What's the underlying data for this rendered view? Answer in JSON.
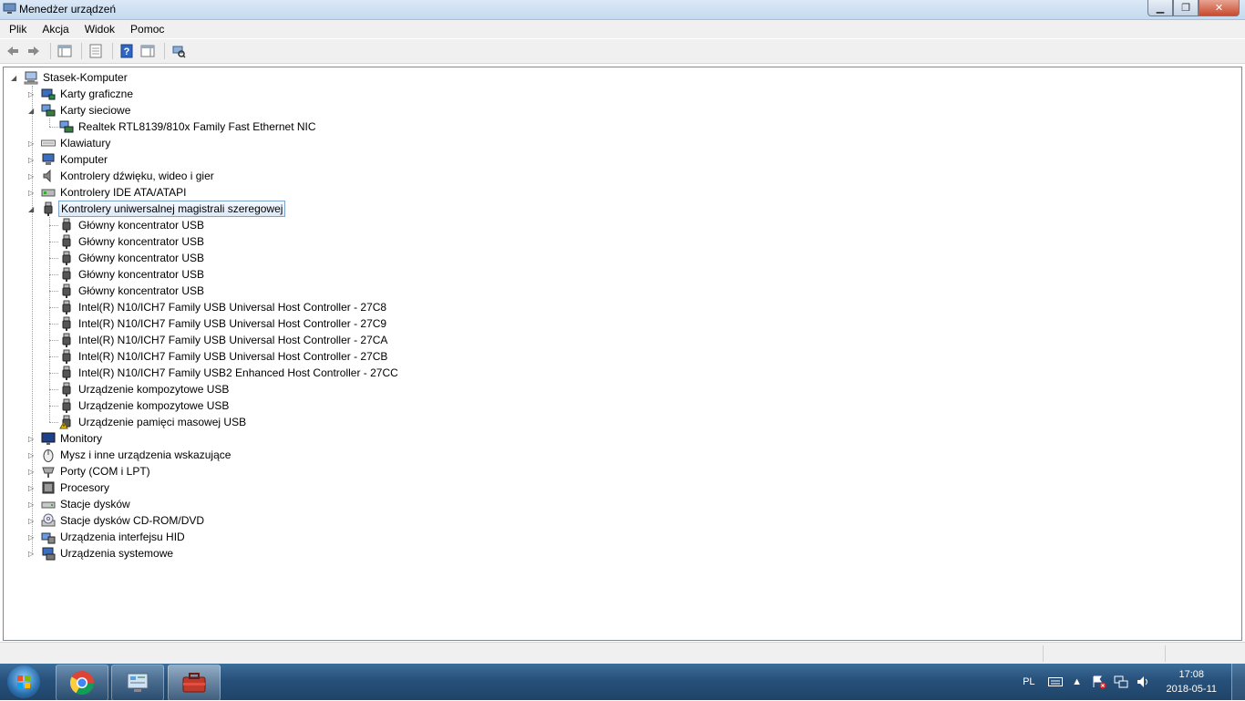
{
  "window": {
    "title": "Menedżer urządzeń",
    "controls": [
      "minimize",
      "maximize",
      "close"
    ]
  },
  "menu": [
    "Plik",
    "Akcja",
    "Widok",
    "Pomoc"
  ],
  "toolbar": {
    "buttons": [
      "back-arrow-icon",
      "forward-arrow-icon",
      "show-hide-tree-icon",
      "properties-icon",
      "help-icon",
      "show-hide-action-pane-icon",
      "scan-hardware-icon"
    ]
  },
  "tree": {
    "root": "Stasek-Komputer",
    "categories": [
      {
        "label": "Karty graficzne",
        "icon": "display-adapter-icon",
        "expanded": false
      },
      {
        "label": "Karty sieciowe",
        "icon": "network-adapter-icon",
        "expanded": true,
        "children": [
          {
            "label": "Realtek RTL8139/810x Family Fast Ethernet NIC",
            "icon": "network-adapter-icon"
          }
        ]
      },
      {
        "label": "Klawiatury",
        "icon": "keyboard-icon",
        "expanded": false
      },
      {
        "label": "Komputer",
        "icon": "computer-icon",
        "expanded": false
      },
      {
        "label": "Kontrolery dźwięku, wideo i gier",
        "icon": "speaker-icon",
        "expanded": false
      },
      {
        "label": "Kontrolery IDE ATA/ATAPI",
        "icon": "ide-controller-icon",
        "expanded": false
      },
      {
        "label": "Kontrolery uniwersalnej magistrali szeregowej",
        "icon": "usb-plug-icon",
        "expanded": true,
        "selected": true,
        "children": [
          {
            "label": "Główny koncentrator USB",
            "icon": "usb-plug-icon"
          },
          {
            "label": "Główny koncentrator USB",
            "icon": "usb-plug-icon"
          },
          {
            "label": "Główny koncentrator USB",
            "icon": "usb-plug-icon"
          },
          {
            "label": "Główny koncentrator USB",
            "icon": "usb-plug-icon"
          },
          {
            "label": "Główny koncentrator USB",
            "icon": "usb-plug-icon"
          },
          {
            "label": "Intel(R) N10/ICH7 Family USB Universal Host Controller - 27C8",
            "icon": "usb-plug-icon"
          },
          {
            "label": "Intel(R) N10/ICH7 Family USB Universal Host Controller - 27C9",
            "icon": "usb-plug-icon"
          },
          {
            "label": "Intel(R) N10/ICH7 Family USB Universal Host Controller - 27CA",
            "icon": "usb-plug-icon"
          },
          {
            "label": "Intel(R) N10/ICH7 Family USB Universal Host Controller - 27CB",
            "icon": "usb-plug-icon"
          },
          {
            "label": "Intel(R) N10/ICH7 Family USB2 Enhanced Host Controller - 27CC",
            "icon": "usb-plug-icon"
          },
          {
            "label": "Urządzenie kompozytowe USB",
            "icon": "usb-plug-icon"
          },
          {
            "label": "Urządzenie kompozytowe USB",
            "icon": "usb-plug-icon"
          },
          {
            "label": "Urządzenie pamięci masowej USB",
            "icon": "usb-warning-icon"
          }
        ]
      },
      {
        "label": "Monitory",
        "icon": "monitor-icon",
        "expanded": false
      },
      {
        "label": "Mysz i inne urządzenia wskazujące",
        "icon": "mouse-icon",
        "expanded": false
      },
      {
        "label": "Porty (COM i LPT)",
        "icon": "port-icon",
        "expanded": false
      },
      {
        "label": "Procesory",
        "icon": "processor-icon",
        "expanded": false
      },
      {
        "label": "Stacje dysków",
        "icon": "disk-drive-icon",
        "expanded": false
      },
      {
        "label": "Stacje dysków CD-ROM/DVD",
        "icon": "cdrom-icon",
        "expanded": false
      },
      {
        "label": "Urządzenia interfejsu HID",
        "icon": "hid-icon",
        "expanded": false
      },
      {
        "label": "Urządzenia systemowe",
        "icon": "system-devices-icon",
        "expanded": false
      }
    ]
  },
  "taskbar": {
    "apps": [
      "chrome-icon",
      "control-panel-icon",
      "device-manager-icon"
    ],
    "tray": {
      "language": "PL",
      "time": "17:08",
      "date": "2018-05-11"
    }
  },
  "colors": {
    "selection_border": "#7da2ce",
    "taskbar": "#27507a",
    "warning": "#f2c200"
  }
}
